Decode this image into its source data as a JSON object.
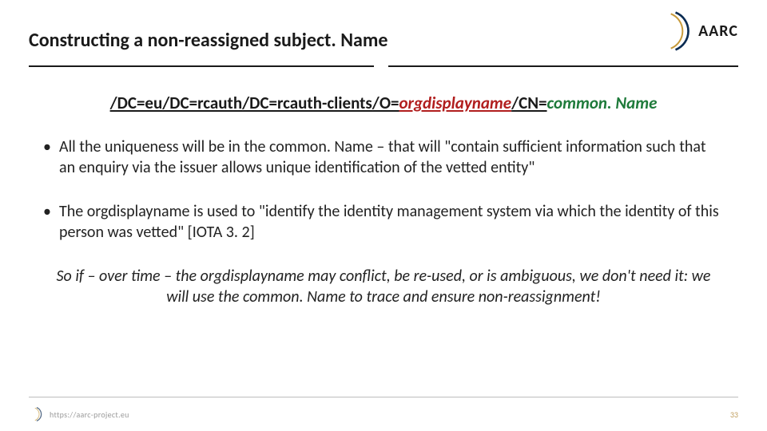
{
  "brand": {
    "logo_text": "AARC"
  },
  "title": "Constructing a non-reassigned subject. Name",
  "dn": {
    "prefix": "/DC=eu/DC=rcauth/DC=rcauth-clients/O=",
    "org": "orgdisplayname",
    "sep": "/CN=",
    "cn": "common. Name"
  },
  "bullets": [
    "All the uniqueness will be in the common. Name – that will \"contain sufficient information such that an enquiry via the issuer allows unique identification of the vetted entity\"",
    "The orgdisplayname is used to \"identify the identity management system via which the identity of this person was vetted\" [IOTA 3. 2]"
  ],
  "conclusion": "So if – over time – the orgdisplayname may conflict, be re-used, or is ambiguous, we don't need it: we will use the common. Name to trace and ensure non-reassignment!",
  "footer": {
    "url": "https://aarc-project.eu",
    "page": "33"
  }
}
